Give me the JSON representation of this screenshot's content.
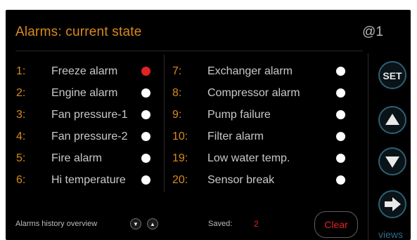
{
  "header": {
    "title": "Alarms: current state",
    "page_id": "@1"
  },
  "alarms_left": [
    {
      "num": "1:",
      "label": "Freeze alarm",
      "active": true
    },
    {
      "num": "2:",
      "label": "Engine alarm",
      "active": false
    },
    {
      "num": "3:",
      "label": "Fan pressure-1",
      "active": false
    },
    {
      "num": "4:",
      "label": "Fan pressure-2",
      "active": false
    },
    {
      "num": "5:",
      "label": "Fire alarm",
      "active": false
    },
    {
      "num": "6:",
      "label": "Hi temperature",
      "active": false
    }
  ],
  "alarms_right": [
    {
      "num": "7:",
      "label": "Exchanger alarm",
      "active": false
    },
    {
      "num": "8:",
      "label": "Compressor alarm",
      "active": false
    },
    {
      "num": "9:",
      "label": "Pump failure",
      "active": false
    },
    {
      "num": "10:",
      "label": "Filter alarm",
      "active": false
    },
    {
      "num": "19:",
      "label": "Low water temp.",
      "active": false
    },
    {
      "num": "20:",
      "label": "Sensor break",
      "active": false
    }
  ],
  "footer": {
    "history_label": "Alarms history overview",
    "saved_label": "Saved:",
    "saved_count": "2",
    "clear_label": "Clear"
  },
  "side_buttons": {
    "set_label": "SET",
    "views_label": "views"
  },
  "colors": {
    "accent_orange": "#d98a1c",
    "alarm_red": "#e32222",
    "button_ring": "#2f5f74"
  }
}
